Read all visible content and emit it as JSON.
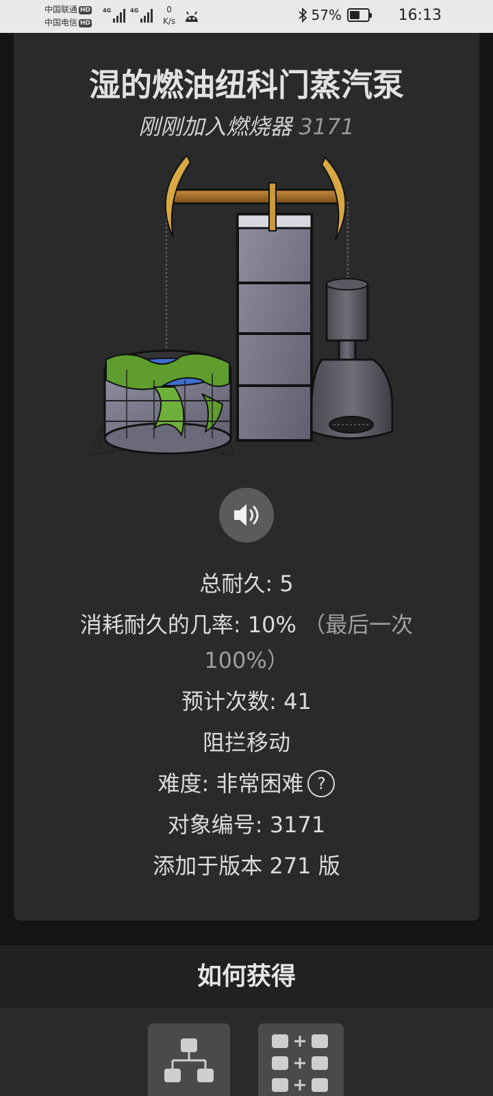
{
  "status_bar": {
    "carrier_1": "中国联通",
    "carrier_2": "中国电信",
    "hd_badge": "HD",
    "network_1": "4G",
    "network_2": "4G",
    "net_speed_value": "0",
    "net_speed_unit": "K/s",
    "battery_percent": "57%",
    "battery_level": 0.57,
    "time": "16:13"
  },
  "item": {
    "title": "湿的燃油纽科门蒸汽泵",
    "subtitle_text": "刚刚加入燃烧器",
    "subtitle_id": "3171",
    "image_alt": "steam-pump-with-well-illustration"
  },
  "stats": {
    "durability": "总耐久: 5",
    "consume_chance": "消耗耐久的几率: 10%",
    "consume_chance_note_1": "（最后一次",
    "consume_chance_note_2": "100%）",
    "expected_uses": "预计次数: 41",
    "blocks_movement": "阻拦移动",
    "difficulty": "难度: 非常困难",
    "difficulty_help": "?",
    "object_id": "对象编号: 3171",
    "added_version": "添加于版本 271 版"
  },
  "how_to_obtain": {
    "heading": "如何获得"
  },
  "icons": {
    "sound": "speaker-icon",
    "tree": "tech-tree-icon",
    "recipe": "recipe-grid-icon"
  }
}
